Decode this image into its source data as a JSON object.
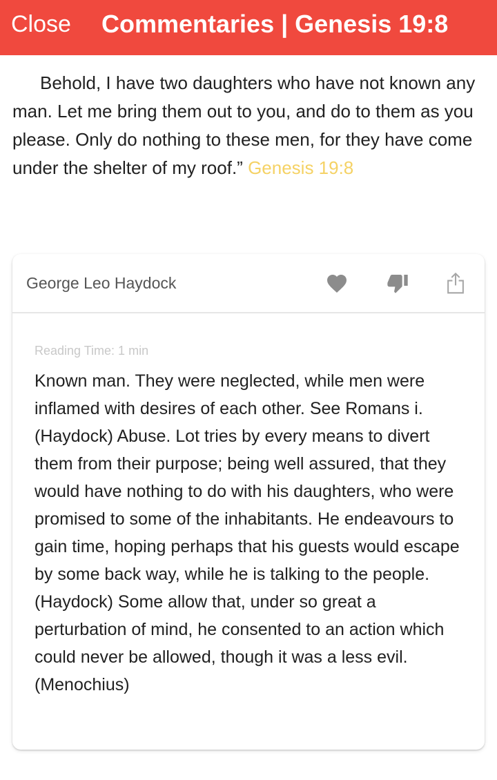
{
  "header": {
    "close_label": "Close",
    "title": "Commentaries | Genesis 19:8",
    "background_color": "#f0493e"
  },
  "verse": {
    "text": "Behold, I have two daughters who have not known any man. Let me bring them out to you, and do to them as you please. Only do nothing to these men, for they have come under the shelter of my roof.”",
    "reference": "Genesis 19:8",
    "reference_color": "#f5d265"
  },
  "commentary_card": {
    "author": "George Leo Haydock",
    "icons": [
      "heart-icon",
      "thumbs-down-icon",
      "share-icon"
    ],
    "reading_time": "Reading Time: 1 min",
    "body": "Known man. They were neglected, while men were inflamed with desires of each other. See Romans i. (Haydock) Abuse. Lot tries by every means to divert them from their purpose; being well assured, that they would have nothing to do with his daughters, who were promised to some of the inhabitants. He endeavours to gain time, hoping perhaps that his guests would escape by some back way, while he is talking to the people. (Haydock) Some allow that, under so great a perturbation of mind, he consented to an action which could never be allowed, though it was a less evil. (Menochius)"
  }
}
